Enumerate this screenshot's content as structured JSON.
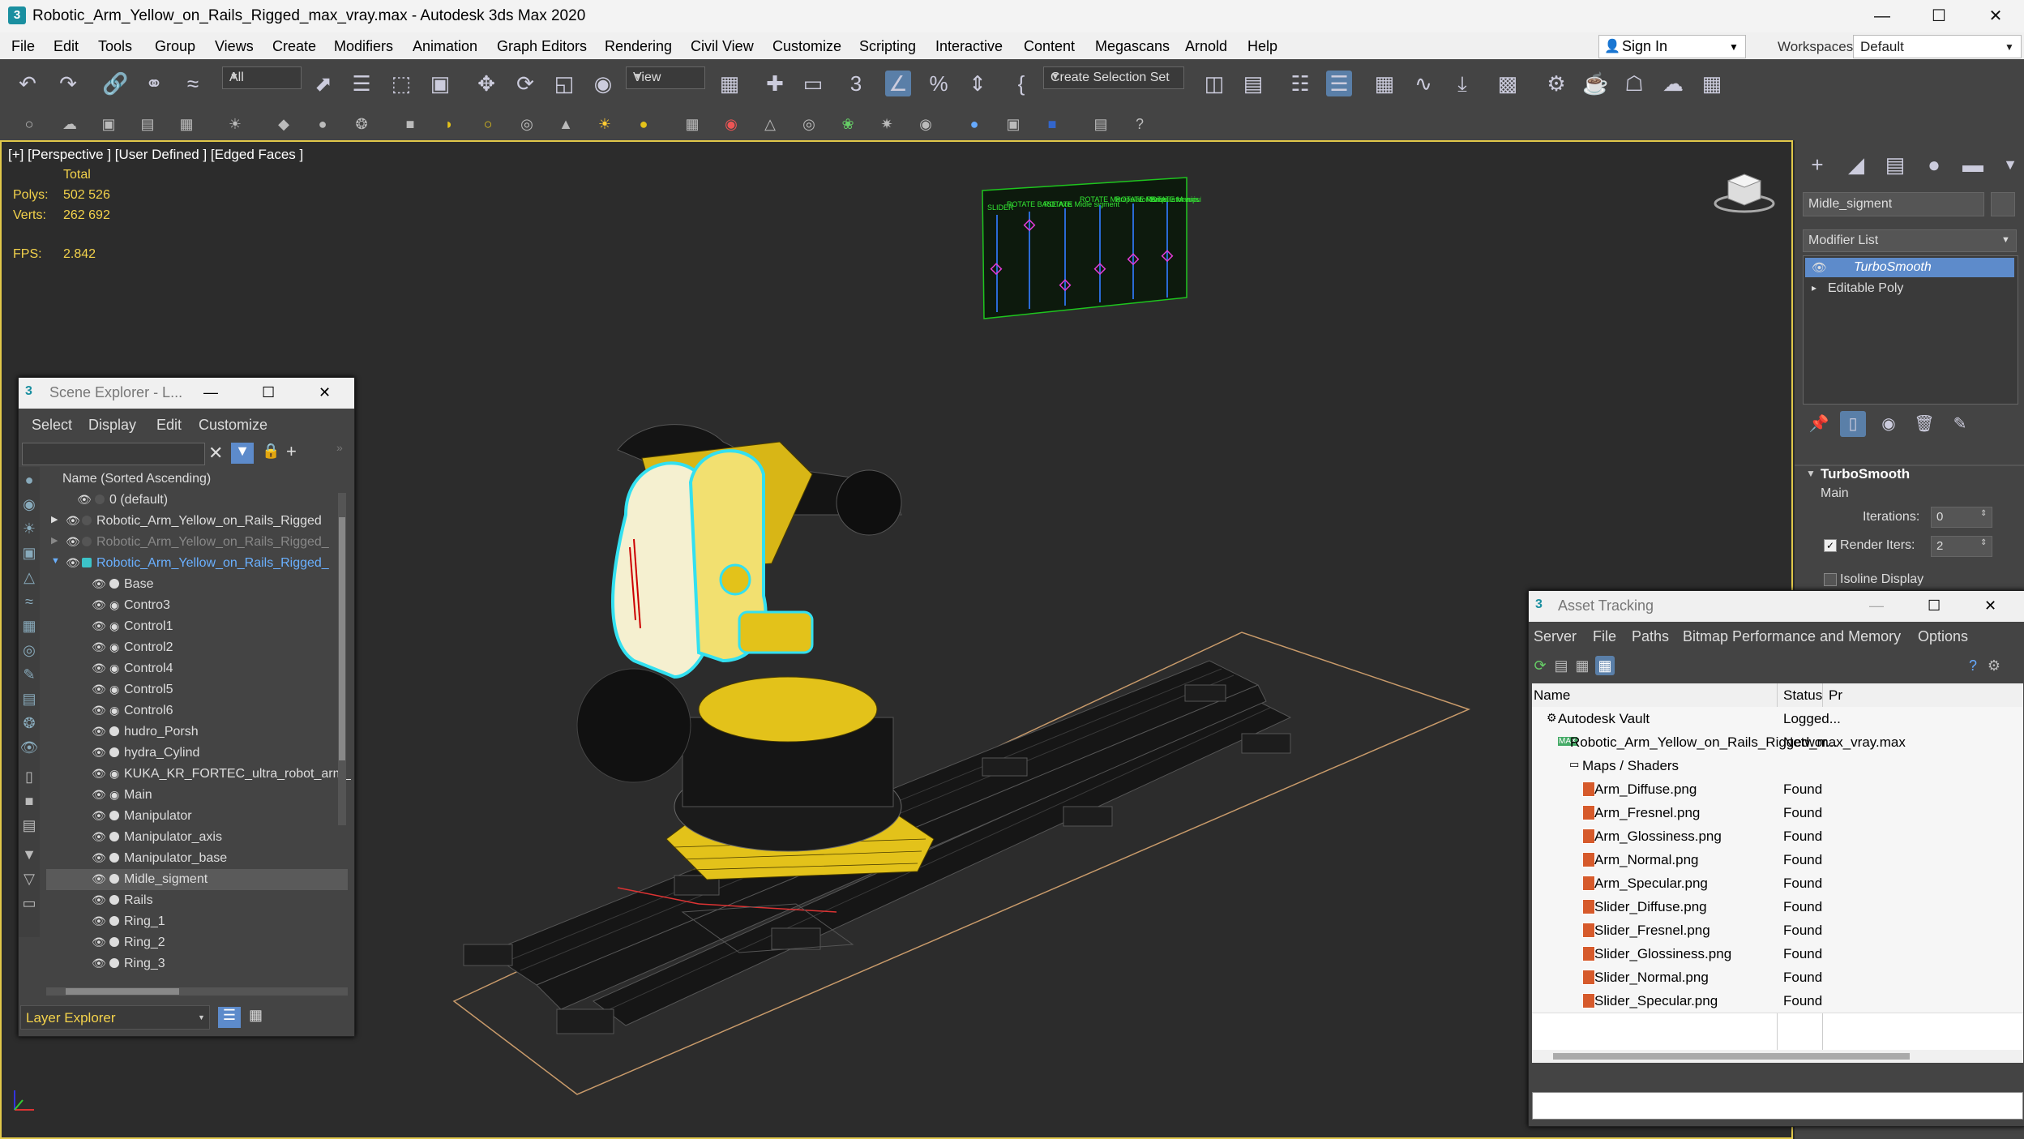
{
  "window": {
    "title": "Robotic_Arm_Yellow_on_Rails_Rigged_max_vray.max - Autodesk 3ds Max 2020",
    "app_icon": "3"
  },
  "menubar": [
    "File",
    "Edit",
    "Tools",
    "Group",
    "Views",
    "Create",
    "Modifiers",
    "Animation",
    "Graph Editors",
    "Rendering",
    "Civil View",
    "Customize",
    "Scripting",
    "Interactive",
    "Content",
    "Megascans",
    "Arnold",
    "Help"
  ],
  "account": {
    "sign_in": "Sign In",
    "workspaces_label": "Workspaces:",
    "workspace": "Default"
  },
  "toolbar": {
    "selection_filter": "All",
    "reference_coord": "View",
    "create_selection_set": "Create Selection Set"
  },
  "viewport": {
    "label": "[+] [Perspective ] [User Defined ] [Edged Faces ]",
    "stats_header": "Total",
    "polys_label": "Polys:",
    "polys": "502 526",
    "verts_label": "Verts:",
    "verts": "262 692",
    "fps_label": "FPS:",
    "fps": "2.842",
    "hud_labels": [
      "SLIDER",
      "ROTATE BASE Axis",
      "ROTATE Midle sigment",
      "ROTATE Manipulator Base",
      "ROTATE Manipulator axis",
      "ROTATE Manipulator"
    ]
  },
  "command_panel": {
    "object_name": "Midle_sigment",
    "modifier_list": "Modifier List",
    "stack": [
      "TurboSmooth",
      "Editable Poly"
    ],
    "rollout_title": "TurboSmooth",
    "main_label": "Main",
    "iterations_label": "Iterations:",
    "iterations": "0",
    "render_iters_label": "Render Iters:",
    "render_iters": "2",
    "isoline_label": "Isoline Display"
  },
  "scene_explorer": {
    "title": "Scene Explorer - L...",
    "menu": [
      "Select",
      "Display",
      "Edit",
      "Customize"
    ],
    "column_header": "Name (Sorted Ascending)",
    "rows": [
      "0 (default)",
      "Robotic_Arm_Yellow_on_Rails_Rigged",
      "Robotic_Arm_Yellow_on_Rails_Rigged_",
      "Robotic_Arm_Yellow_on_Rails_Rigged_",
      "Base",
      "Contro3",
      "Control1",
      "Control2",
      "Control4",
      "Control5",
      "Control6",
      "hudro_Porsh",
      "hydra_Cylind",
      "KUKA_KR_FORTEC_ultra_robot_arm_",
      "Main",
      "Manipulator",
      "Manipulator_axis",
      "Manipulator_base",
      "Midle_sigment",
      "Rails",
      "Ring_1",
      "Ring_2",
      "Ring_3"
    ],
    "footer": "Layer Explorer"
  },
  "asset_tracking": {
    "title": "Asset Tracking",
    "menu": [
      "Server",
      "File",
      "Paths",
      "Bitmap Performance and Memory",
      "Options"
    ],
    "col_name": "Name",
    "col_status": "Status",
    "col_extra": "Pr",
    "rows": [
      {
        "name": "Autodesk Vault",
        "status": "Logged..."
      },
      {
        "name": "Robotic_Arm_Yellow_on_Rails_Rigged_max_vray.max",
        "status": "Networ..."
      },
      {
        "name": "Maps / Shaders",
        "status": ""
      },
      {
        "name": "Arm_Diffuse.png",
        "status": "Found"
      },
      {
        "name": "Arm_Fresnel.png",
        "status": "Found"
      },
      {
        "name": "Arm_Glossiness.png",
        "status": "Found"
      },
      {
        "name": "Arm_Normal.png",
        "status": "Found"
      },
      {
        "name": "Arm_Specular.png",
        "status": "Found"
      },
      {
        "name": "Slider_Diffuse.png",
        "status": "Found"
      },
      {
        "name": "Slider_Fresnel.png",
        "status": "Found"
      },
      {
        "name": "Slider_Glossiness.png",
        "status": "Found"
      },
      {
        "name": "Slider_Normal.png",
        "status": "Found"
      },
      {
        "name": "Slider_Specular.png",
        "status": "Found"
      }
    ]
  },
  "colors": {
    "accent": "#5a7fa8",
    "stats_yellow": "#f3d24b",
    "viewport_border": "#e1c84a",
    "selection_blue": "#4a7fc8",
    "robot_yellow": "#e3c21a"
  }
}
